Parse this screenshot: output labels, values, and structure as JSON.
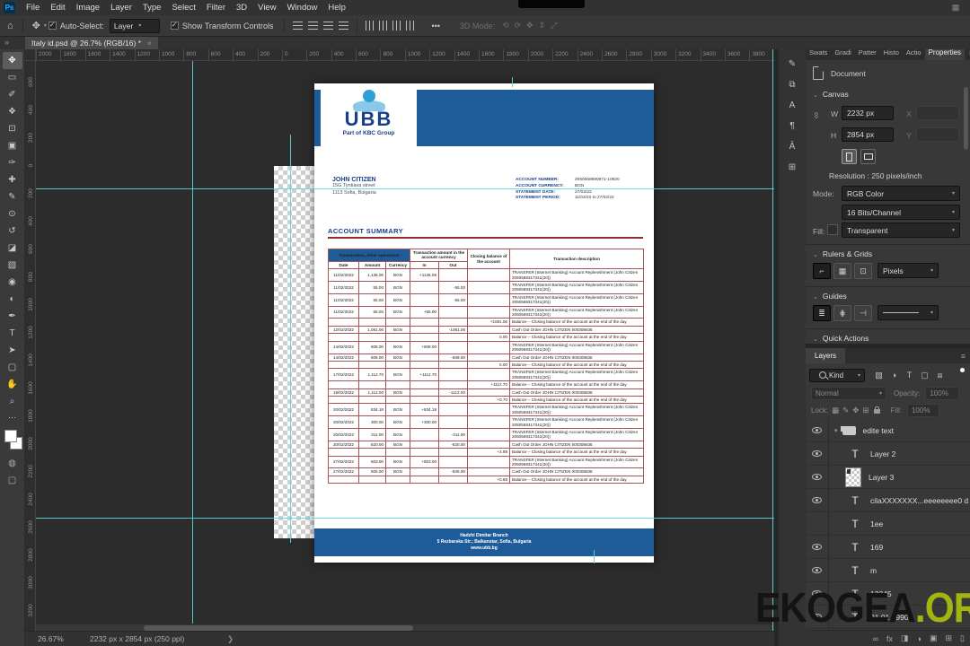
{
  "colors": {
    "navy": "#1d5c99",
    "logoblue": "#2f9fd6",
    "logolight": "#8ac8e8",
    "logonavy": "#173f8a",
    "tborder": "#a85454",
    "tred": "#8b2f2f",
    "cyan": "#5ad8d8",
    "wmgreen": "#a2b410",
    "wmblack": "#141414"
  },
  "menu": {
    "logo": "Ps",
    "items": [
      "File",
      "Edit",
      "Image",
      "Layer",
      "Type",
      "Select",
      "Filter",
      "3D",
      "View",
      "Window",
      "Help"
    ]
  },
  "options_bar": {
    "home_icon": "⌂",
    "move_icon": "✥",
    "auto_select_label": "Auto-Select:",
    "auto_select_value": "Layer",
    "transform_label": "Show Transform Controls",
    "more_label": "•••",
    "mode_label": "3D Mode:",
    "mode_icons": [
      "⟲",
      "⟳",
      "✥",
      "⇕",
      "⤢"
    ]
  },
  "document_tab": {
    "overflow": "»",
    "title": "Italy id.psd @ 26.7% (RGB/16) *",
    "close": "×"
  },
  "tools": [
    {
      "name": "move-tool",
      "glyph": "✥",
      "sel": "sel"
    },
    {
      "name": "marquee-tool",
      "glyph": "▭"
    },
    {
      "name": "lasso-tool",
      "glyph": "✐"
    },
    {
      "name": "object-selection-tool",
      "glyph": "❖"
    },
    {
      "name": "crop-tool",
      "glyph": "⊡"
    },
    {
      "name": "frame-tool",
      "glyph": "▣"
    },
    {
      "name": "eyedropper-tool",
      "glyph": "✑"
    },
    {
      "name": "healing-brush-tool",
      "glyph": "✚"
    },
    {
      "name": "brush-tool",
      "glyph": "✎"
    },
    {
      "name": "clone-stamp-tool",
      "glyph": "⊙"
    },
    {
      "name": "history-brush-tool",
      "glyph": "↺"
    },
    {
      "name": "eraser-tool",
      "glyph": "◪"
    },
    {
      "name": "gradient-tool",
      "glyph": "▧"
    },
    {
      "name": "blur-tool",
      "glyph": "◉"
    },
    {
      "name": "dodge-tool",
      "glyph": "◐"
    },
    {
      "name": "pen-tool",
      "glyph": "✒"
    },
    {
      "name": "type-tool",
      "glyph": "T"
    },
    {
      "name": "path-select-tool",
      "glyph": "➤"
    },
    {
      "name": "shape-tool",
      "glyph": "▢"
    },
    {
      "name": "hand-tool",
      "glyph": "✋"
    },
    {
      "name": "zoom-tool",
      "glyph": "⌕"
    }
  ],
  "toolbar_more": "⋯",
  "quick_mask_icon": "◍",
  "screen_mode_icon": "▢",
  "rulers": {
    "h_labels": [
      "2000",
      "1800",
      "1600",
      "1400",
      "1200",
      "1000",
      "800",
      "600",
      "400",
      "200",
      "0",
      "200",
      "400",
      "600",
      "800",
      "1000",
      "1200",
      "1400",
      "1600",
      "1800",
      "2000",
      "2200",
      "2400",
      "2600",
      "2800",
      "3000",
      "3200",
      "3400",
      "3600",
      "3800"
    ],
    "v_labels": [
      "600",
      "400",
      "200",
      "0",
      "200",
      "400",
      "600",
      "800",
      "1000",
      "1200",
      "1400",
      "1600",
      "1800",
      "2000",
      "2200",
      "2400",
      "2600",
      "2800",
      "3000",
      "3200"
    ]
  },
  "statement": {
    "bank": {
      "logo_text": "UBB",
      "logo_tagline": "Part of KBC Group"
    },
    "customer": {
      "name": "JOHN CITIZEN",
      "address1": "15G Tyntiava street",
      "address2": "1113 Sofia, Bulgaria"
    },
    "account_info": [
      {
        "label": "ACCOUNT NUMBER:",
        "value": "2050069880871-10520"
      },
      {
        "label": "ACCOUNT CURRENCY:",
        "value": "BGN"
      },
      {
        "label": "STATEMENT DATE:",
        "value": "27/02/22"
      },
      {
        "label": "STATEMENT PERIOD:",
        "value": "11/02/22 to 27/02/22"
      }
    ],
    "summary_title": "ACCOUNT SUMMARY",
    "table": {
      "header": {
        "group1": "Transactions, other operations",
        "group2": "Transaction amount in the account currency",
        "closing": "Closing balance of the account",
        "description": "Transaction description",
        "date": "Date",
        "amount": "Amount",
        "currency": "Currency",
        "in": "In",
        "out": "Out"
      },
      "rows": [
        {
          "date": "11/02/2022",
          "amount": "1,136.06",
          "currency": "BGN",
          "in": "+1136.06",
          "out": "",
          "balance": "",
          "desc": "TRANSFER (Internet Banking) Account Replenishment (John Citizen 2050569317341(20))"
        },
        {
          "date": "11/02/2022",
          "amount": "55.00",
          "currency": "BGN",
          "in": "",
          "out": "-55.00",
          "balance": "",
          "desc": "TRANSFER (Internet Banking) Account Replenishment (John Citizen 2050569317341(20))"
        },
        {
          "date": "11/02/2022",
          "amount": "55.00",
          "currency": "BGN",
          "in": "",
          "out": "-55.00",
          "balance": "",
          "desc": "TRANSFER (Internet Banking) Account Replenishment (John Citizen 2050569317341(20))"
        },
        {
          "date": "11/02/2022",
          "amount": "55.00",
          "currency": "BGN",
          "in": "+55.00",
          "out": "",
          "balance": "",
          "desc": "TRANSFER (Internet Banking) Account Replenishment (John Citizen 2050569317341(20))"
        },
        {
          "date": "",
          "amount": "",
          "currency": "",
          "in": "",
          "out": "",
          "balance": "+1081.06",
          "desc": "Balance – Closing balance of the account at the end of the day"
        },
        {
          "date": "12/02/2022",
          "amount": "1,081.06",
          "currency": "BGN",
          "in": "",
          "out": "-1081.06",
          "balance": "",
          "desc": "Cash Out Order JOHN CITIZEN 000308636"
        },
        {
          "date": "",
          "amount": "",
          "currency": "",
          "in": "",
          "out": "",
          "balance": "0.00",
          "desc": "Balance – Closing balance of the account at the end of the day"
        },
        {
          "date": "14/02/2022",
          "amount": "608.00",
          "currency": "BGN",
          "in": "+608.00",
          "out": "",
          "balance": "",
          "desc": "TRANSFER (Internet Banking) Account Replenishment (John Citizen 2050569317341(20))"
        },
        {
          "date": "14/02/2022",
          "amount": "608.00",
          "currency": "BGN",
          "in": "",
          "out": "-608.00",
          "balance": "",
          "desc": "Cash Out Order JOHN CITIZEN 000308636"
        },
        {
          "date": "",
          "amount": "",
          "currency": "",
          "in": "",
          "out": "",
          "balance": "0.00",
          "desc": "Balance – Closing balance of the account at the end of the day"
        },
        {
          "date": "17/02/2022",
          "amount": "1,112.70",
          "currency": "BGN",
          "in": "+1112.70",
          "out": "",
          "balance": "",
          "desc": "TRANSFER (Internet Banking) Account Replenishment (John Citizen 2050569317341(20))"
        },
        {
          "date": "",
          "amount": "",
          "currency": "",
          "in": "",
          "out": "",
          "balance": "+1112.70",
          "desc": "Balance – Closing balance of the account at the end of the day"
        },
        {
          "date": "18/02/2022",
          "amount": "1,112.00",
          "currency": "BGN",
          "in": "",
          "out": "-1112.00",
          "balance": "",
          "desc": "Cash Out Order JOHN CITIZEN 000308636"
        },
        {
          "date": "",
          "amount": "",
          "currency": "",
          "in": "",
          "out": "",
          "balance": "+0.70",
          "desc": "Balance – Closing balance of the account at the end of the day"
        },
        {
          "date": "20/02/2022",
          "amount": "834.18",
          "currency": "BGN",
          "in": "+834.18",
          "out": "",
          "balance": "",
          "desc": "TRANSFER (Internet Banking) Account Replenishment (John Citizen 2050569317341(20))"
        },
        {
          "date": "20/02/2022",
          "amount": "300.00",
          "currency": "BGN",
          "in": "+300.00",
          "out": "",
          "balance": "",
          "desc": "TRANSFER (Internet Banking) Account Replenishment (John Citizen 2050569317341(20))"
        },
        {
          "date": "20/02/2022",
          "amount": "311.00",
          "currency": "BGN",
          "in": "",
          "out": "-311.00",
          "balance": "",
          "desc": "TRANSFER (Internet Banking) Account Replenishment (John Citizen 2050569317341(20))"
        },
        {
          "date": "20/02/2022",
          "amount": "820.00",
          "currency": "BGN",
          "in": "",
          "out": "-820.00",
          "balance": "",
          "desc": "Cash Out Order JOHN CITIZEN 000308636"
        },
        {
          "date": "",
          "amount": "",
          "currency": "",
          "in": "",
          "out": "",
          "balance": "+3.88",
          "desc": "Balance – Closing balance of the account at the end of the day"
        },
        {
          "date": "27/02/2022",
          "amount": "503.00",
          "currency": "BGN",
          "in": "+503.00",
          "out": "",
          "balance": "",
          "desc": "TRANSFER (Internet Banking) Account Replenishment (John Citizen 2050569317341(20))"
        },
        {
          "date": "27/02/2022",
          "amount": "506.00",
          "currency": "BGN",
          "in": "",
          "out": "-506.00",
          "balance": "",
          "desc": "Cash Out Order JOHN CITIZEN 000308636"
        },
        {
          "date": "",
          "amount": "",
          "currency": "",
          "in": "",
          "out": "",
          "balance": "+0.88",
          "desc": "Balance – Closing balance of the account at the end of the day"
        }
      ]
    },
    "footer": {
      "line1": "Hadzhi Dimitar Branch",
      "line2": "5 Rezbarska Str.; Balkanstar, Sofia, Bulgaria",
      "line3": "www.ubb.bg"
    }
  },
  "collapsed_icons": [
    {
      "name": "brushes-panel-icon",
      "glyph": "✎"
    },
    {
      "name": "clone-source-panel-icon",
      "glyph": "⧉"
    },
    {
      "name": "character-panel-icon",
      "glyph": "A"
    },
    {
      "name": "paragraph-panel-icon",
      "glyph": "¶"
    },
    {
      "name": "glyphs-panel-icon",
      "glyph": "Ā"
    },
    {
      "name": "libraries-panel-icon",
      "glyph": "⊞"
    }
  ],
  "properties_panel": {
    "tabs": [
      "Swats",
      "Gradi",
      "Patter",
      "Histo",
      "Actio"
    ],
    "active_tab": "Properties",
    "menu_icon": "≡",
    "document_label": "Document",
    "canvas_section": "Canvas",
    "w_label": "W",
    "w_value": "2232 px",
    "x_label": "X",
    "h_label": "H",
    "h_value": "2854 px",
    "y_label": "Y",
    "resolution": "Resolution : 250 pixels/inch",
    "mode_label": "Mode:",
    "mode_value": "RGB Color",
    "depth_value": "16 Bits/Channel",
    "fill_label": "Fill:",
    "fill_value": "Transparent",
    "rulers_section": "Rulers & Grids",
    "rulers_unit": "Pixels",
    "guides_section": "Guides",
    "quick_actions_section": "Quick Actions"
  },
  "layers_panel": {
    "tab": "Layers",
    "menu_icon": "≡",
    "kind_label": "Kind",
    "filter_icons": [
      "▨",
      "◑",
      "T",
      "▢",
      "⧈"
    ],
    "blend_mode": "Normal",
    "opacity_label": "Opacity:",
    "opacity_value": "100%",
    "lock_label": "Lock:",
    "lock_icons": [
      "▦",
      "✎",
      "✥",
      "⊞"
    ],
    "fill_label": "Fill:",
    "fill_value": "100%",
    "layers": [
      {
        "name": "edite text",
        "type": "group",
        "visible": true
      },
      {
        "name": "Layer 2",
        "type": "text",
        "visible": true
      },
      {
        "name": "Layer 3",
        "type": "pixel",
        "visible": true
      },
      {
        "name": "cilaXXXXXXX...eeeeeeee0 d",
        "type": "text",
        "visible": true
      },
      {
        "name": "1ee",
        "type": "text",
        "visible": false
      },
      {
        "name": "169",
        "type": "text",
        "visible": true
      },
      {
        "name": "m",
        "type": "text",
        "visible": true
      },
      {
        "name": "12345",
        "type": "text",
        "visible": true
      },
      {
        "name": "01.01.1990",
        "type": "text",
        "visible": true
      }
    ],
    "bottom_icons": [
      {
        "name": "link-layers-icon",
        "glyph": "∞"
      },
      {
        "name": "layer-effects-icon",
        "glyph": "fx"
      },
      {
        "name": "layer-mask-icon",
        "glyph": "◨"
      },
      {
        "name": "adjustment-layer-icon",
        "glyph": "◑"
      },
      {
        "name": "new-group-icon",
        "glyph": "▣"
      },
      {
        "name": "new-layer-icon",
        "glyph": "⊞"
      },
      {
        "name": "delete-layer-icon",
        "glyph": "▯"
      }
    ]
  },
  "status_bar": {
    "zoom": "26.67%",
    "doc_size": "2232 px x 2854 px (250 ppi)",
    "chevron": "❯"
  },
  "watermark": {
    "black": "EKOGEA",
    "green": ".ORG"
  }
}
